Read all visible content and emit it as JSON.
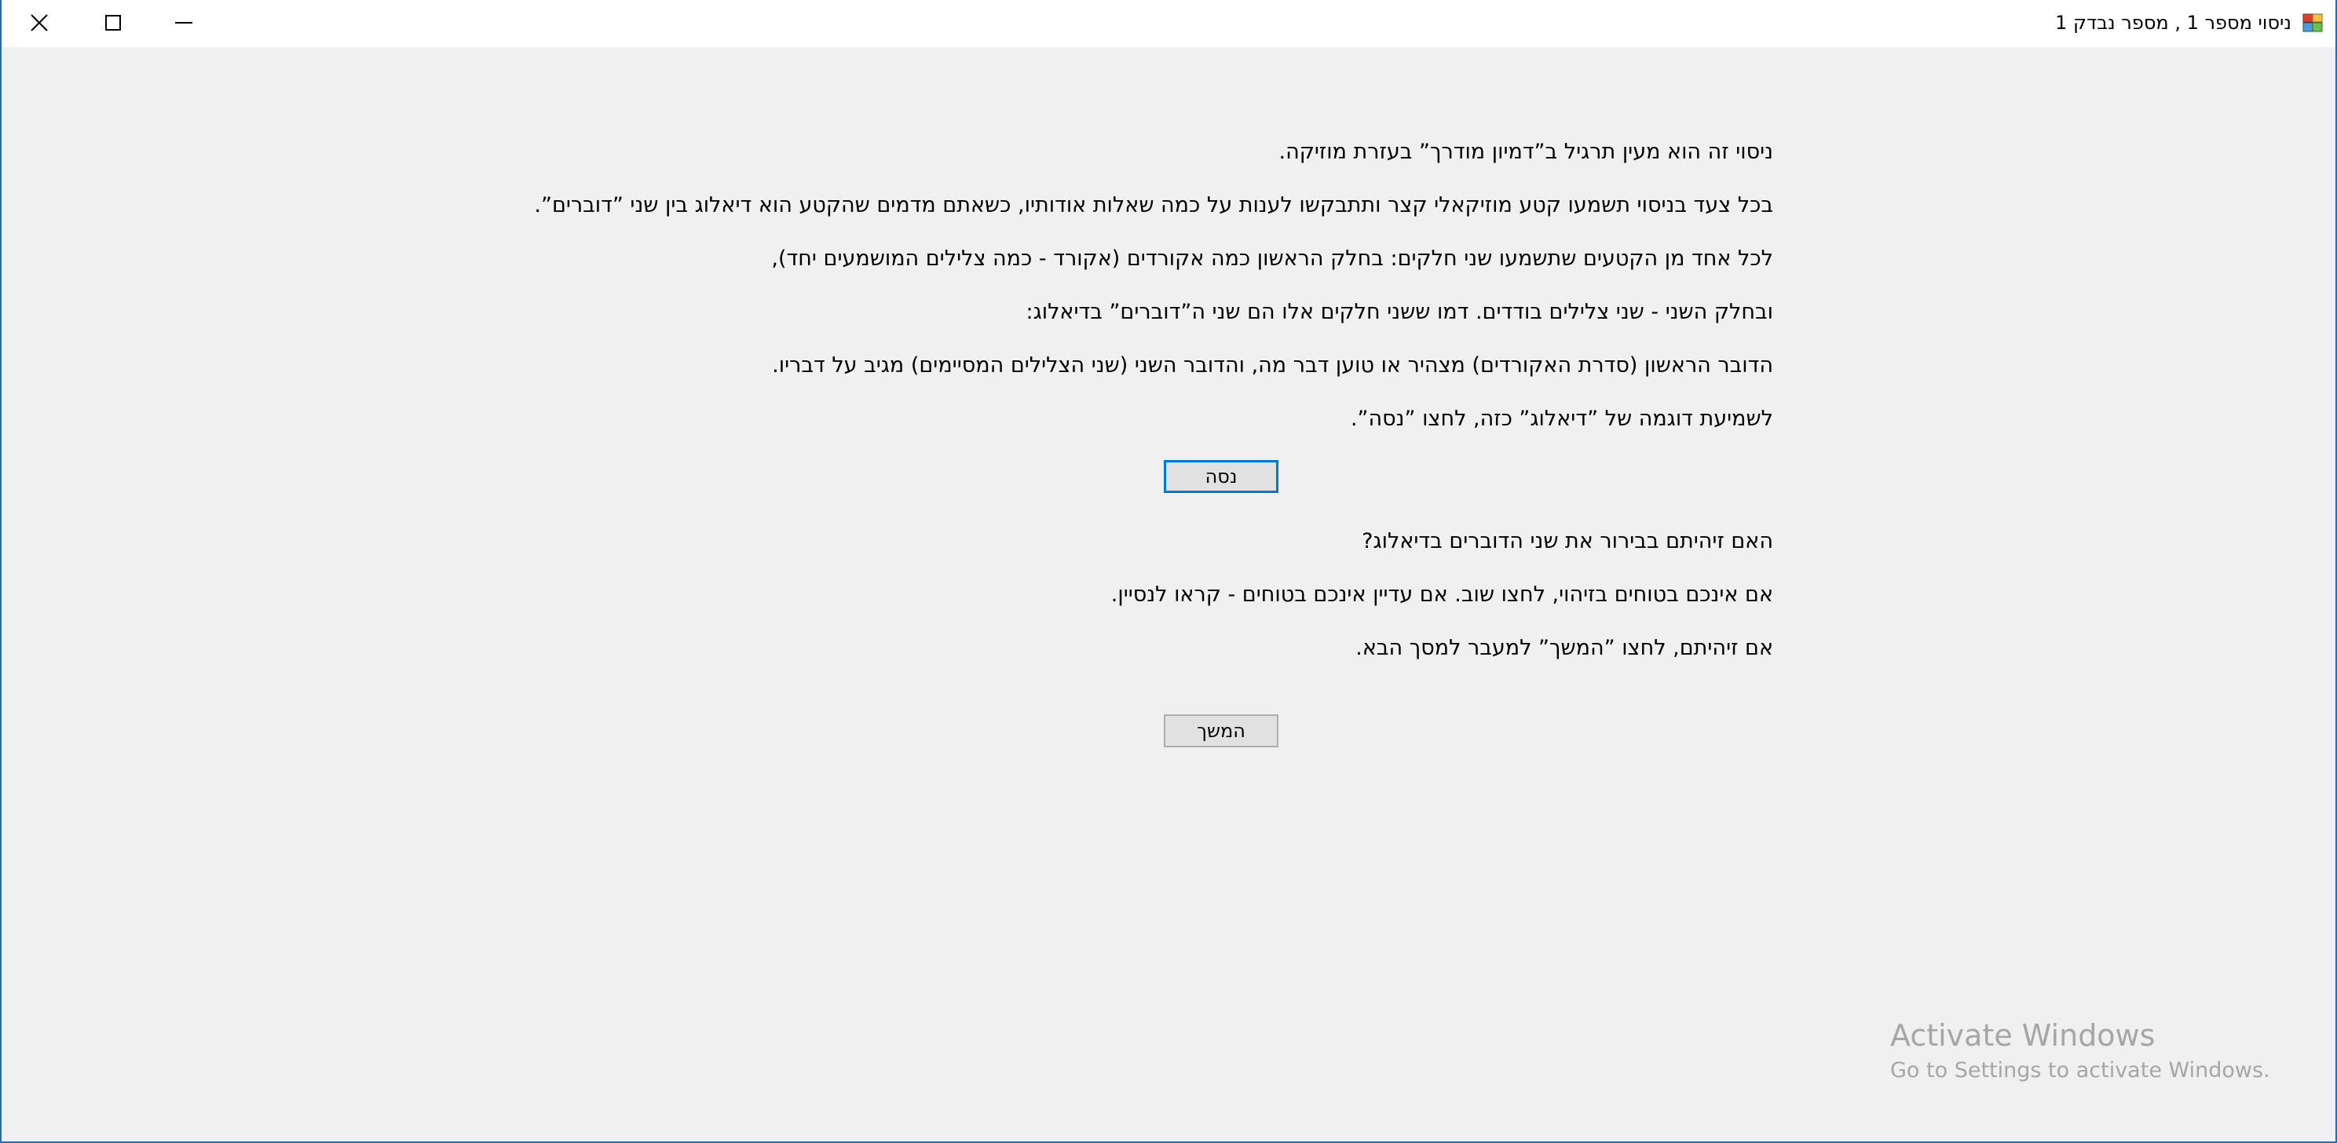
{
  "window": {
    "title": "ניסוי מספר 1 , מספר נבדק 1",
    "buttons": [
      "close-icon",
      "maximize-icon",
      "minimize-icon"
    ]
  },
  "instructions": {
    "lines": [
      "ניסוי זה הוא מעין תרגיל ב”דמיון מודרך” בעזרת מוזיקה.",
      "בכל צעד בניסוי תשמעו קטע מוזיקאלי קצר ותתבקשו לענות על כמה שאלות אודותיו, כשאתם מדמים שהקטע הוא דיאלוג בין שני ”דוברים”.",
      "לכל אחד מן הקטעים שתשמעו שני חלקים: בחלק הראשון כמה אקורדים (אקורד - כמה צלילים המושמעים יחד),",
      "ובחלק השני - שני צלילים בודדים. דמו ששני חלקים אלו הם שני ה”דוברים” בדיאלוג:",
      "הדובר הראשון (סדרת האקורדים) מצהיר או טוען דבר מה, והדובר השני (שני הצלילים המסיימים) מגיב על דבריו.",
      "לשמיעת דוגמה של ”דיאלוג” כזה, לחצו ”נסה”."
    ],
    "try_button": "נסה",
    "questions": [
      "האם זיהיתם בבירור את שני הדוברים בדיאלוג?",
      "אם אינכם בטוחים בזיהוי, לחצו שוב. אם עדיין אינכם בטוחים - קראו לנסיין.",
      "אם זיהיתם, לחצו ”המשך” למעבר למסך הבא."
    ],
    "next_button": "המשך"
  },
  "watermark": {
    "title": "Activate Windows",
    "subtitle": "Go to Settings to activate Windows."
  },
  "colors": {
    "background": "#f0f0f0",
    "focus_border": "#0078d7",
    "watermark": "#a6a6a6"
  }
}
